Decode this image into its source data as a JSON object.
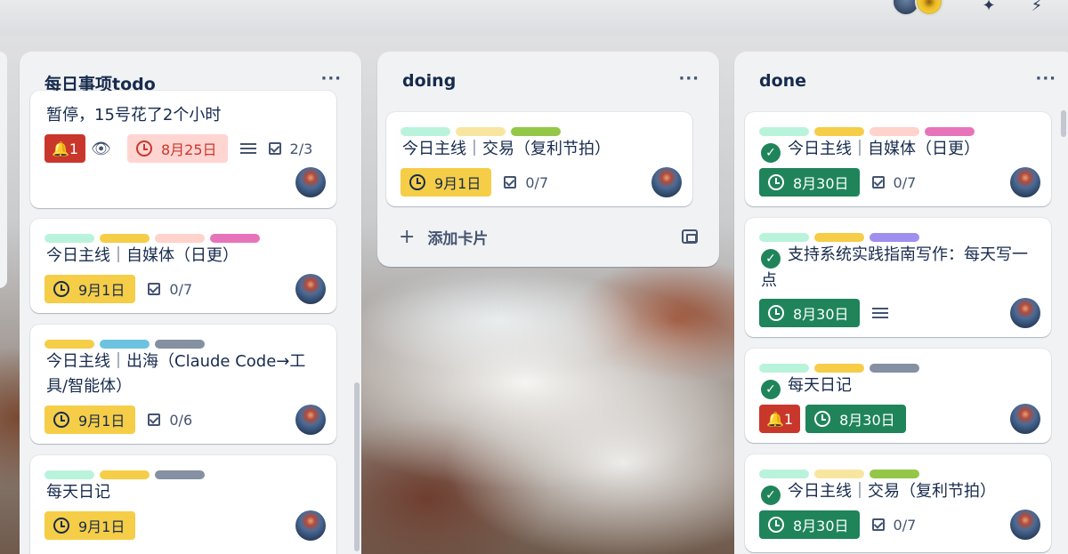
{
  "header": {
    "members": [
      "avatar-1",
      "avatar-2"
    ],
    "icons": [
      "automation-icon",
      "power-up-icon"
    ]
  },
  "lists": [
    {
      "title": "每日事项todo",
      "menu": "···",
      "cards": [
        {
          "title": "暂停，15号花了2个小时",
          "notifications": "1",
          "date": "8月25日",
          "checklist": "2/3"
        },
        {
          "labels": [
            "#baf3db",
            "#f5cd47",
            "#ffd2cc",
            "#e774bb"
          ],
          "title": "今日主线｜自媒体（日更）",
          "date": "9月1日",
          "checklist": "0/7"
        },
        {
          "labels": [
            "#f5cd47",
            "#6cc3e0",
            "#8590a2"
          ],
          "title": "今日主线｜出海（Claude Code→工具/智能体）",
          "date": "9月1日",
          "checklist": "0/6"
        },
        {
          "labels": [
            "#baf3db",
            "#f5cd47",
            "#8590a2"
          ],
          "title": "每天日记",
          "date": "9月1日"
        }
      ]
    },
    {
      "title": "doing",
      "menu": "···",
      "cards": [
        {
          "labels": [
            "#baf3db",
            "#f8e6a0",
            "#94c748"
          ],
          "title": "今日主线｜交易（复利节拍）",
          "date": "9月1日",
          "checklist": "0/7"
        }
      ],
      "add_card": "添加卡片"
    },
    {
      "title": "done",
      "menu": "···",
      "cards": [
        {
          "labels": [
            "#baf3db",
            "#f5cd47",
            "#ffd2cc",
            "#e774bb"
          ],
          "title": "今日主线｜自媒体（日更）",
          "date": "8月30日",
          "checklist": "0/7"
        },
        {
          "labels": [
            "#baf3db",
            "#f5cd47",
            "#9f8fef"
          ],
          "title": "支持系统实践指南写作：每天写一点",
          "date": "8月30日"
        },
        {
          "labels": [
            "#baf3db",
            "#f5cd47",
            "#8590a2"
          ],
          "title": "每天日记",
          "notifications": "1",
          "date": "8月30日"
        },
        {
          "labels": [
            "#baf3db",
            "#f8e6a0",
            "#94c748"
          ],
          "title": "今日主线｜交易（复利节拍）",
          "date": "8月30日",
          "checklist": "0/7"
        }
      ]
    }
  ]
}
